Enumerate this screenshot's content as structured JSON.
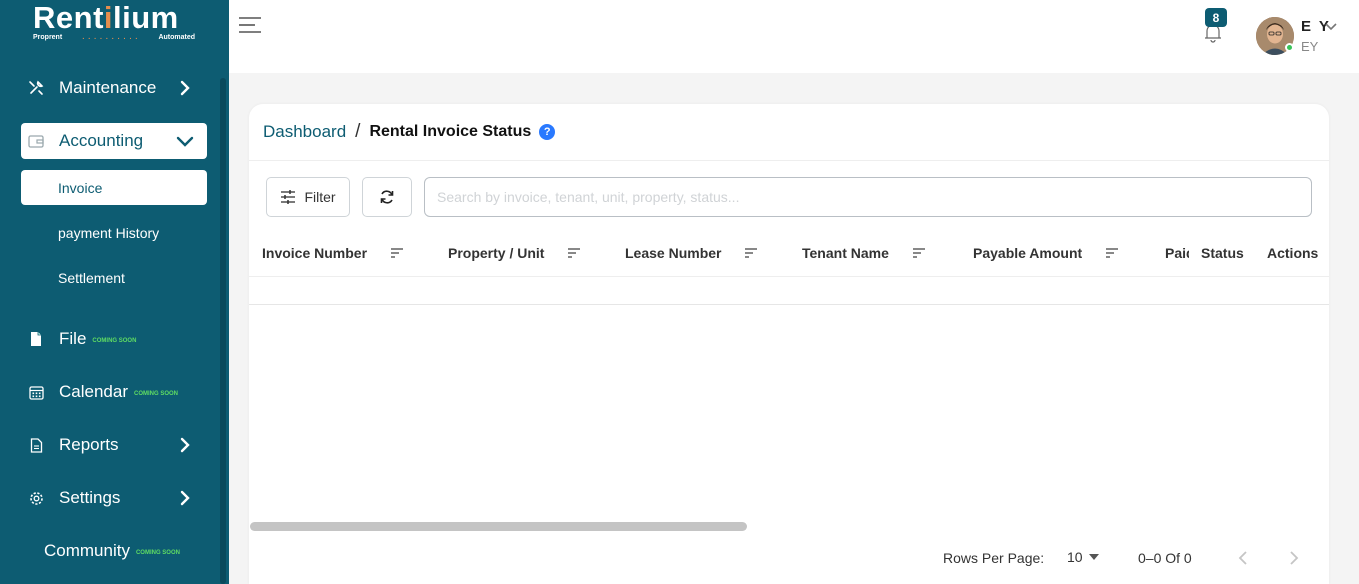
{
  "brand": {
    "name_part1": "Rent",
    "name_i": "i",
    "name_part2": "lium",
    "tagline_left": "Proprent",
    "tagline_right": "Automated"
  },
  "sidebar": {
    "items": [
      {
        "label": "Maintenance"
      },
      {
        "label": "Accounting"
      },
      {
        "label": "File",
        "badge": "COMING SOON"
      },
      {
        "label": "Calendar",
        "badge": "COMING SOON"
      },
      {
        "label": "Reports"
      },
      {
        "label": "Settings"
      },
      {
        "label": "Community",
        "badge": "COMING SOON"
      }
    ],
    "accounting_sub": [
      {
        "label": "Invoice"
      },
      {
        "label": "payment History"
      },
      {
        "label": "Settlement"
      }
    ]
  },
  "header": {
    "notification_count": "8",
    "user_initials": "E Y",
    "user_sub": "EY"
  },
  "breadcrumb": {
    "root": "Dashboard",
    "separator": "/",
    "current": "Rental Invoice Status",
    "help": "?"
  },
  "toolbar": {
    "filter_label": "Filter",
    "search_placeholder": "Search by invoice, tenant, unit, property, status..."
  },
  "table": {
    "columns": [
      "Invoice Number",
      "Property / Unit",
      "Lease Number",
      "Tenant Name",
      "Payable Amount",
      "Paid",
      "Status",
      "Actions"
    ]
  },
  "pagination": {
    "rows_label": "Rows Per Page:",
    "rows_value": "10",
    "range": "0–0 Of 0"
  },
  "colors": {
    "sidebar": "#0d5c72",
    "accent": "#e58e4e",
    "coming_soon": "#5fdc63",
    "help": "#2979ff"
  }
}
